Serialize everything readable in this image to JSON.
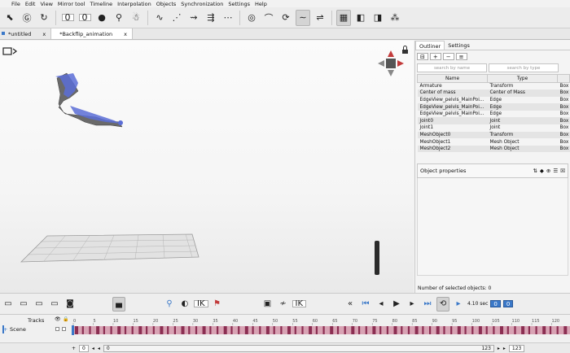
{
  "menu": [
    "File",
    "Edit",
    "View",
    "Mirror tool",
    "Timeline",
    "Interpolation",
    "Objects",
    "Synchronization",
    "Settings",
    "Help"
  ],
  "tabs": [
    {
      "label": "*untitled",
      "close": "x"
    },
    {
      "label": "*Backflip_animation",
      "close": "x"
    }
  ],
  "toolbar": {
    "rotate_field": "0",
    "frame_field": "0"
  },
  "outliner": {
    "tabs": [
      "Outliner",
      "Settings"
    ],
    "search_name": "search by name",
    "search_type": "search by type",
    "columns": [
      "Name",
      "Type",
      ""
    ],
    "rows": [
      [
        "Armature",
        "Transform",
        "Box"
      ],
      [
        "Center of mass",
        "Center of Mass",
        "Box"
      ],
      [
        "EdgeView_pelvis_MainPoi...",
        "Edge",
        "Box"
      ],
      [
        "EdgeView_pelvis_MainPoi...",
        "Edge",
        "Box"
      ],
      [
        "EdgeView_pelvis_MainPoi...",
        "Edge",
        "Box"
      ],
      [
        "Joint0",
        "Joint",
        "Box"
      ],
      [
        "Joint1",
        "Joint",
        "Box"
      ],
      [
        "MeshObject0",
        "Transform",
        "Box"
      ],
      [
        "MeshObject1",
        "Mesh Object",
        "Box"
      ],
      [
        "MeshObject2",
        "Mesh Object",
        "Box"
      ]
    ],
    "props_title": "Object properties",
    "selected_label": "Number of selected objects: 0"
  },
  "bottom": {
    "ik1": "IK",
    "ik2": "IK",
    "time": "4.10 sec",
    "time_field": "0",
    "end_field": "0"
  },
  "timeline": {
    "tracks_label": "Tracks",
    "scene_label": "Scene",
    "ruler": [
      "0",
      "5",
      "10",
      "15",
      "20",
      "25",
      "30",
      "35",
      "40",
      "45",
      "50",
      "55",
      "60",
      "65",
      "70",
      "75",
      "80",
      "85",
      "90",
      "95",
      "100",
      "105",
      "110",
      "115",
      "120"
    ]
  },
  "status": {
    "start": "0",
    "cur": "0",
    "end_left": "123",
    "end_right": "123"
  },
  "colors": {
    "accent": "#3a78c8",
    "key_dark": "#8b2e52",
    "key_light": "#d8a3b4"
  }
}
